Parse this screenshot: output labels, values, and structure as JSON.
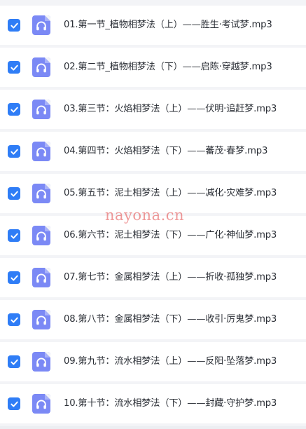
{
  "file_list": {
    "items": [
      {
        "name": "01.第一节_植物相梦法（上）——胜生·考试梦.mp3",
        "checked": true,
        "icon": "audio-file-icon"
      },
      {
        "name": "02.第二节_植物相梦法（下）——启陈·穿越梦.mp3",
        "checked": true,
        "icon": "audio-file-icon"
      },
      {
        "name": "03.第三节：火焰相梦法（上）——伏明·追赶梦.mp3",
        "checked": true,
        "icon": "audio-file-icon"
      },
      {
        "name": "04.第四节：火焰相梦法（下）——蕃茂·春梦.mp3",
        "checked": true,
        "icon": "audio-file-icon"
      },
      {
        "name": "05.第五节：泥土相梦法（上）——减化·灾难梦.mp3",
        "checked": true,
        "icon": "audio-file-icon"
      },
      {
        "name": "06.第六节：泥土相梦法（下）——广化·神仙梦.mp3",
        "checked": true,
        "icon": "audio-file-icon"
      },
      {
        "name": "07.第七节：金属相梦法（上）——折收·孤独梦.mp3",
        "checked": true,
        "icon": "audio-file-icon"
      },
      {
        "name": "08.第八节：金属相梦法（下）——收引·厉鬼梦.mp3",
        "checked": true,
        "icon": "audio-file-icon"
      },
      {
        "name": "09.第九节：流水相梦法（上）——反阳·坠落梦.mp3",
        "checked": true,
        "icon": "audio-file-icon"
      },
      {
        "name": "10.第十节：流水相梦法（下）——封藏·守护梦.mp3",
        "checked": true,
        "icon": "audio-file-icon"
      }
    ]
  },
  "watermark": {
    "text": "nayona.cn"
  },
  "colors": {
    "checkbox": "#2f7df6",
    "file_icon": "#7b89f5",
    "row_background": "#ffffff",
    "page_background": "#f3f4f7",
    "text": "#2b2f36",
    "watermark": "#e24646"
  }
}
